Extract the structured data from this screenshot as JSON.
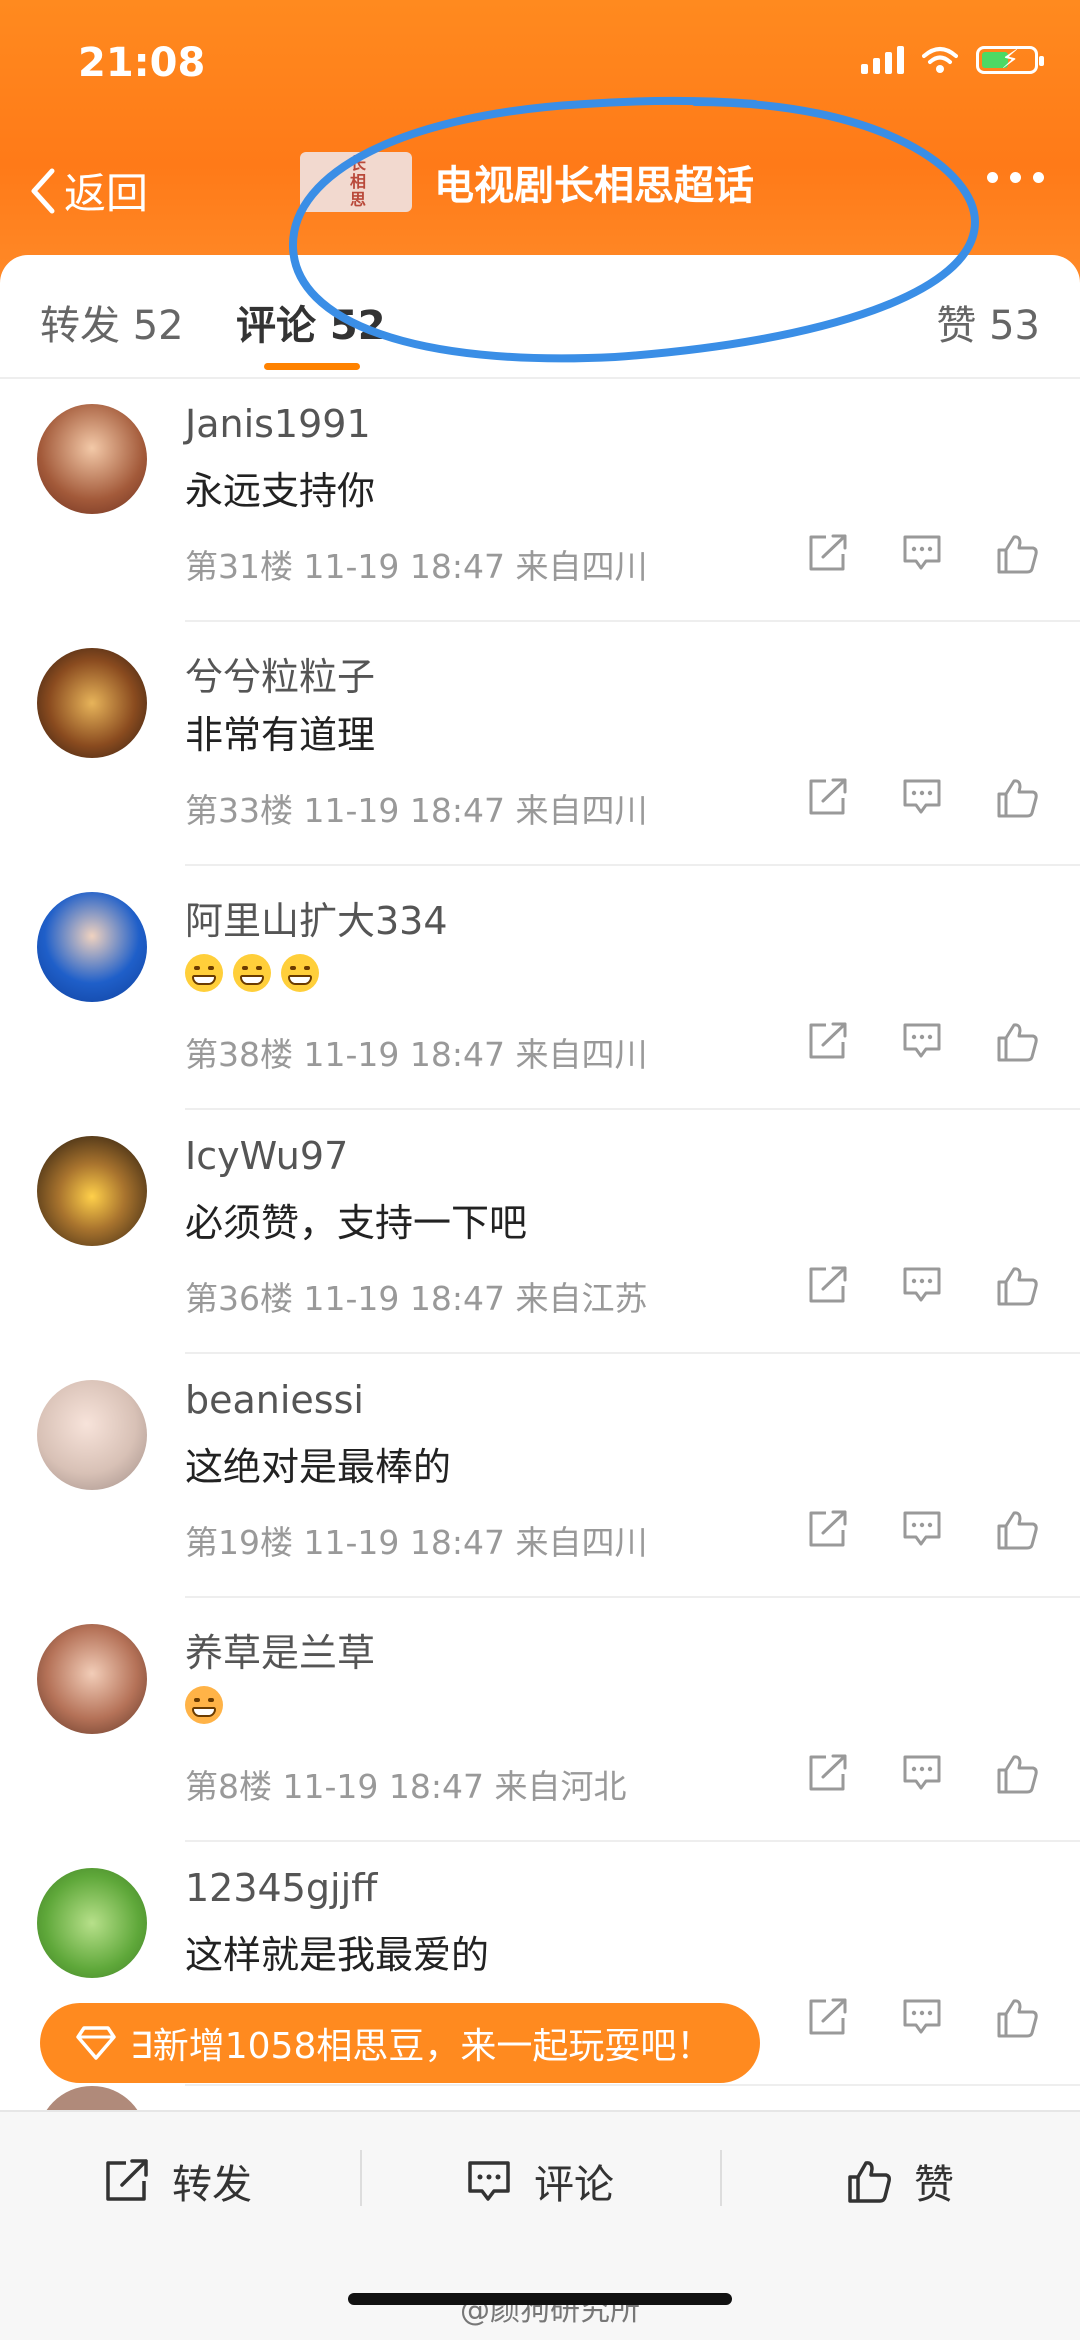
{
  "status_bar": {
    "time": "21:08"
  },
  "nav": {
    "back_label": "返回",
    "title": "电视剧长相思超话",
    "thumb_text": "长相思"
  },
  "tabs": [
    {
      "label": "转发 52"
    },
    {
      "label": "评论 52"
    },
    {
      "label": "赞 53"
    }
  ],
  "comments": [
    {
      "user": "Janis1991",
      "text": "永远支持你",
      "meta": "第31楼 11-19 18:47 来自四川"
    },
    {
      "user": "兮兮粒粒子",
      "text": "非常有道理",
      "meta": "第33楼 11-19 18:47 来自四川"
    },
    {
      "user": "阿里山扩大334",
      "text": "",
      "meta": "第38楼 11-19 18:47 来自四川"
    },
    {
      "user": "IcyWu97",
      "text": "必须赞，支持一下吧",
      "meta": "第36楼 11-19 18:47 来自江苏"
    },
    {
      "user": "beaniessi",
      "text": "这绝对是最棒的",
      "meta": "第19楼 11-19 18:47 来自四川"
    },
    {
      "user": "养草是兰草",
      "text": "",
      "meta": "第8楼 11-19 18:47 来自河北"
    },
    {
      "user": "12345gjjff",
      "text": "这样就是我最爱的",
      "meta": ""
    }
  ],
  "toast": {
    "text": "∃新增1058相思豆，来一起玩耍吧！"
  },
  "bottom_bar": {
    "repost": "转发",
    "comment": "评论",
    "like": "赞"
  },
  "watermark": "@颜狗研究所",
  "colors": {
    "accent": "#ff8200",
    "annotation": "#3a8ee6"
  }
}
